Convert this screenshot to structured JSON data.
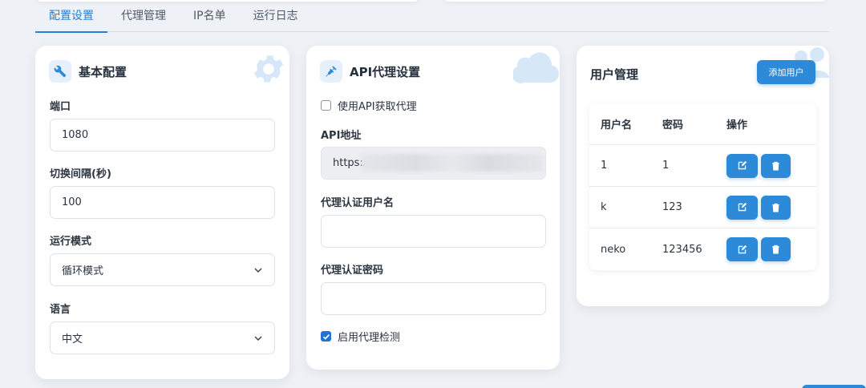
{
  "tabs": [
    "配置设置",
    "代理管理",
    "IP名单",
    "运行日志"
  ],
  "basic": {
    "title": "基本配置",
    "port_label": "端口",
    "port_value": "1080",
    "interval_label": "切换间隔(秒)",
    "interval_value": "100",
    "mode_label": "运行模式",
    "mode_value": "循环模式",
    "lang_label": "语言",
    "lang_value": "中文"
  },
  "api": {
    "title": "API代理设置",
    "use_api_label": "使用API获取代理",
    "use_api_checked": false,
    "api_addr_label": "API地址",
    "api_addr_value": "https:/",
    "auth_user_label": "代理认证用户名",
    "auth_user_value": "",
    "auth_pass_label": "代理认证密码",
    "auth_pass_value": "",
    "enable_check_label": "启用代理检测",
    "enable_check_checked": true
  },
  "users": {
    "title": "用户管理",
    "add_button": "添加用户",
    "columns": [
      "用户名",
      "密码",
      "操作"
    ],
    "rows": [
      {
        "username": "1",
        "password": "1"
      },
      {
        "username": "k",
        "password": "123"
      },
      {
        "username": "neko",
        "password": "123456"
      }
    ]
  },
  "icons": {
    "basic": "wrench-icon",
    "api": "plug-icon",
    "edit": "edit-icon",
    "delete": "trash-icon",
    "chevron": "chevron-down-icon"
  },
  "colors": {
    "accent": "#2d8ad9",
    "tab_active": "#2a7fd4",
    "checkbox": "#1f73d6"
  }
}
